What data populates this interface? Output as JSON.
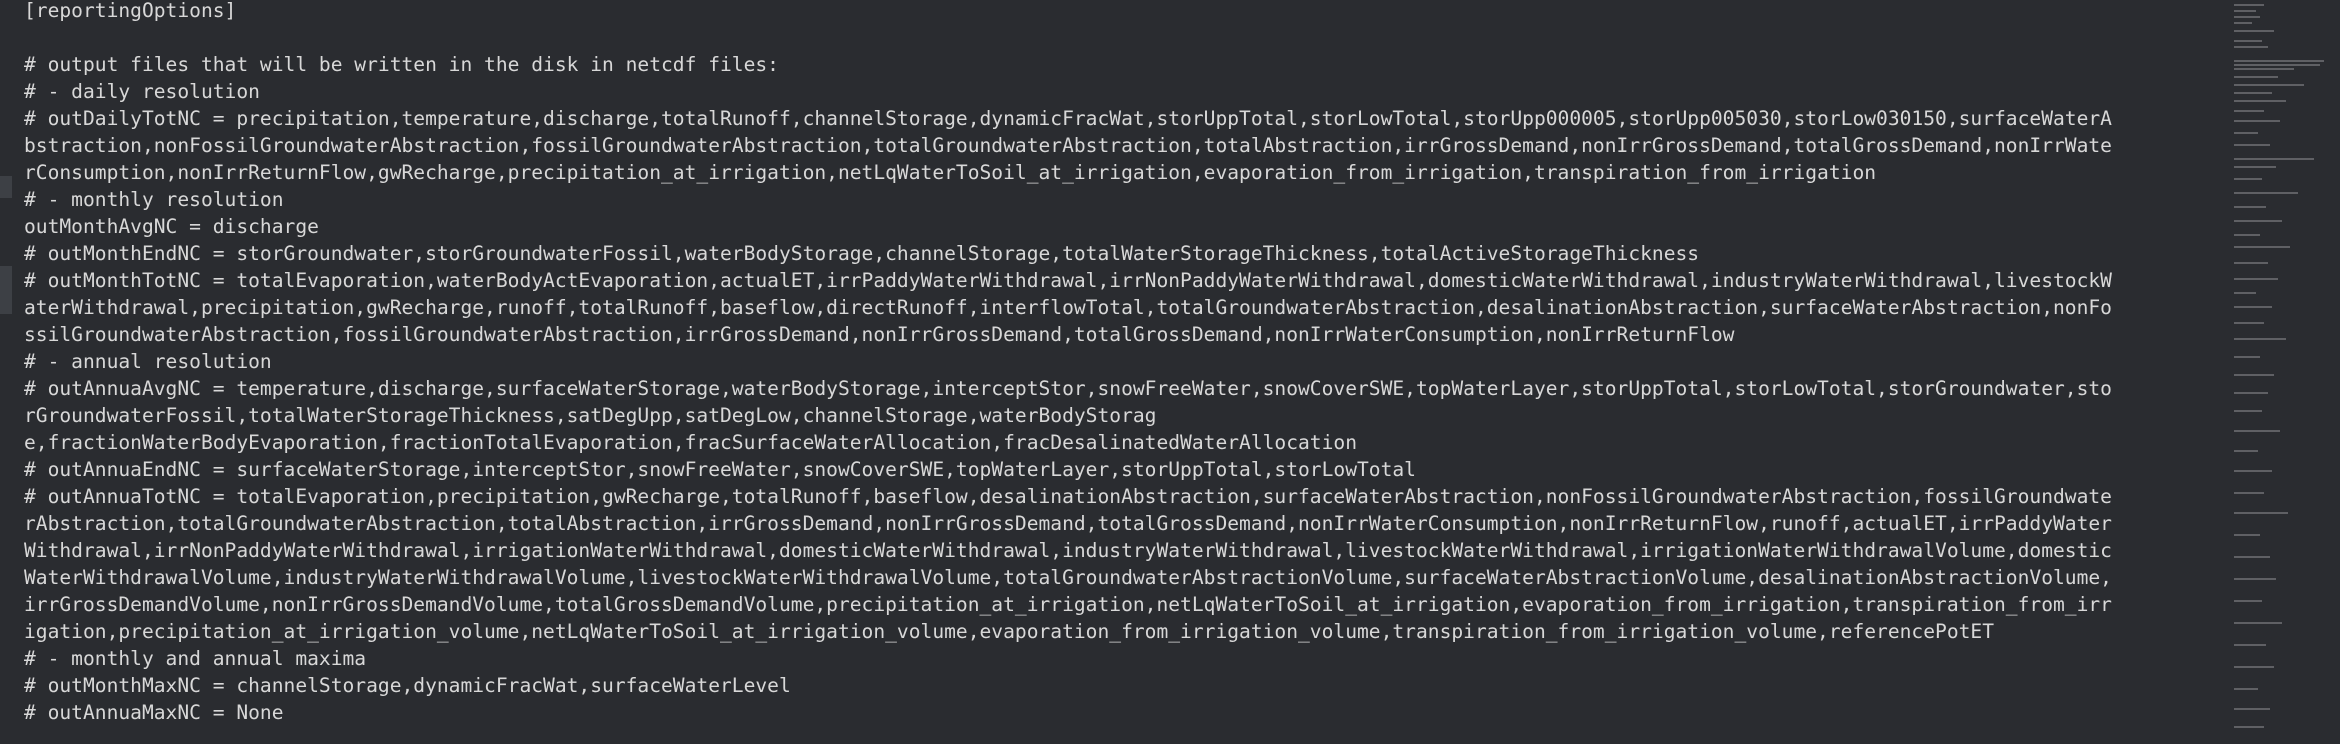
{
  "editor": {
    "lines": [
      "[reportingOptions]",
      "",
      "# output files that will be written in the disk in netcdf files:",
      "# - daily resolution",
      "# outDailyTotNC = precipitation,temperature,discharge,totalRunoff,channelStorage,dynamicFracWat,storUppTotal,storLowTotal,storUpp000005,storUpp005030,storLow030150,surfaceWaterA",
      "bstraction,nonFossilGroundwaterAbstraction,fossilGroundwaterAbstraction,totalGroundwaterAbstraction,totalAbstraction,irrGrossDemand,nonIrrGrossDemand,totalGrossDemand,nonIrrWate",
      "rConsumption,nonIrrReturnFlow,gwRecharge,precipitation_at_irrigation,netLqWaterToSoil_at_irrigation,evaporation_from_irrigation,transpiration_from_irrigation",
      "# - monthly resolution",
      "outMonthAvgNC = discharge",
      "# outMonthEndNC = storGroundwater,storGroundwaterFossil,waterBodyStorage,channelStorage,totalWaterStorageThickness,totalActiveStorageThickness",
      "# outMonthTotNC = totalEvaporation,waterBodyActEvaporation,actualET,irrPaddyWaterWithdrawal,irrNonPaddyWaterWithdrawal,domesticWaterWithdrawal,industryWaterWithdrawal,livestockW",
      "aterWithdrawal,precipitation,gwRecharge,runoff,totalRunoff,baseflow,directRunoff,interflowTotal,totalGroundwaterAbstraction,desalinationAbstraction,surfaceWaterAbstraction,nonFo",
      "ssilGroundwaterAbstraction,fossilGroundwaterAbstraction,irrGrossDemand,nonIrrGrossDemand,totalGrossDemand,nonIrrWaterConsumption,nonIrrReturnFlow",
      "# - annual resolution",
      "# outAnnuaAvgNC = temperature,discharge,surfaceWaterStorage,waterBodyStorage,interceptStor,snowFreeWater,snowCoverSWE,topWaterLayer,storUppTotal,storLowTotal,storGroundwater,sto",
      "rGroundwaterFossil,totalWaterStorageThickness,satDegUpp,satDegLow,channelStorage,waterBodyStorag",
      "e,fractionWaterBodyEvaporation,fractionTotalEvaporation,fracSurfaceWaterAllocation,fracDesalinatedWaterAllocation",
      "# outAnnuaEndNC = surfaceWaterStorage,interceptStor,snowFreeWater,snowCoverSWE,topWaterLayer,storUppTotal,storLowTotal",
      "# outAnnuaTotNC = totalEvaporation,precipitation,gwRecharge,totalRunoff,baseflow,desalinationAbstraction,surfaceWaterAbstraction,nonFossilGroundwaterAbstraction,fossilGroundwate",
      "rAbstraction,totalGroundwaterAbstraction,totalAbstraction,irrGrossDemand,nonIrrGrossDemand,totalGrossDemand,nonIrrWaterConsumption,nonIrrReturnFlow,runoff,actualET,irrPaddyWater",
      "Withdrawal,irrNonPaddyWaterWithdrawal,irrigationWaterWithdrawal,domesticWaterWithdrawal,industryWaterWithdrawal,livestockWaterWithdrawal,irrigationWaterWithdrawalVolume,domestic",
      "WaterWithdrawalVolume,industryWaterWithdrawalVolume,livestockWaterWithdrawalVolume,totalGroundwaterAbstractionVolume,surfaceWaterAbstractionVolume,desalinationAbstractionVolume,",
      "irrGrossDemandVolume,nonIrrGrossDemandVolume,totalGrossDemandVolume,precipitation_at_irrigation,netLqWaterToSoil_at_irrigation,evaporation_from_irrigation,transpiration_from_irr",
      "igation,precipitation_at_irrigation_volume,netLqWaterToSoil_at_irrigation_volume,evaporation_from_irrigation_volume,transpiration_from_irrigation_volume,referencePotET",
      "# - monthly and annual maxima",
      "# outMonthMaxNC = channelStorage,dynamicFracWat,surfaceWaterLevel",
      "# outAnnuaMaxNC = None"
    ]
  }
}
